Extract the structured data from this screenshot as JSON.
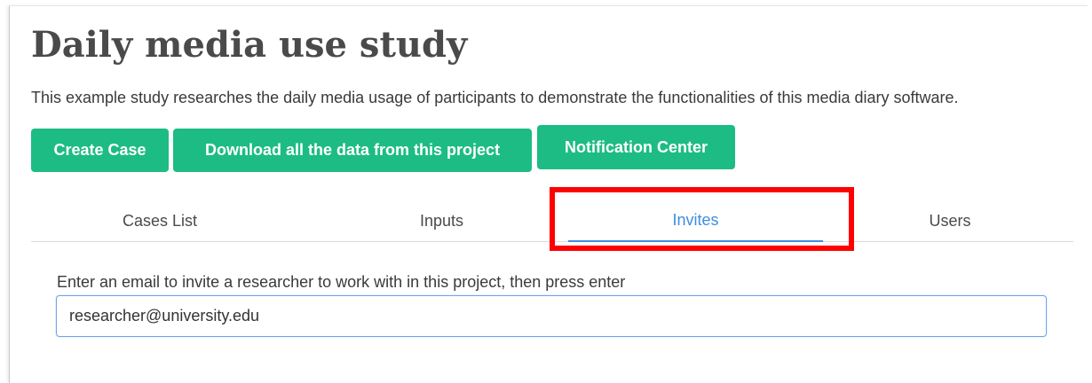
{
  "project": {
    "title": "Daily media use study",
    "description": "This example study researches the daily media usage of participants to demonstrate the functionalities of this media diary software."
  },
  "actions": {
    "create_case": "Create Case",
    "download_all": "Download all the data from this project",
    "notification_center": "Notification Center"
  },
  "tabs": [
    {
      "label": "Cases List",
      "active": false
    },
    {
      "label": "Inputs",
      "active": false
    },
    {
      "label": "Invites",
      "active": true
    },
    {
      "label": "Users",
      "active": false
    }
  ],
  "invite": {
    "label": "Enter an email to invite a researcher to work with in this project, then press enter",
    "value": "researcher@university.edu"
  },
  "colors": {
    "button": "#1dbc84",
    "active_tab": "#3d8ee0",
    "highlight": "#ff0000"
  }
}
